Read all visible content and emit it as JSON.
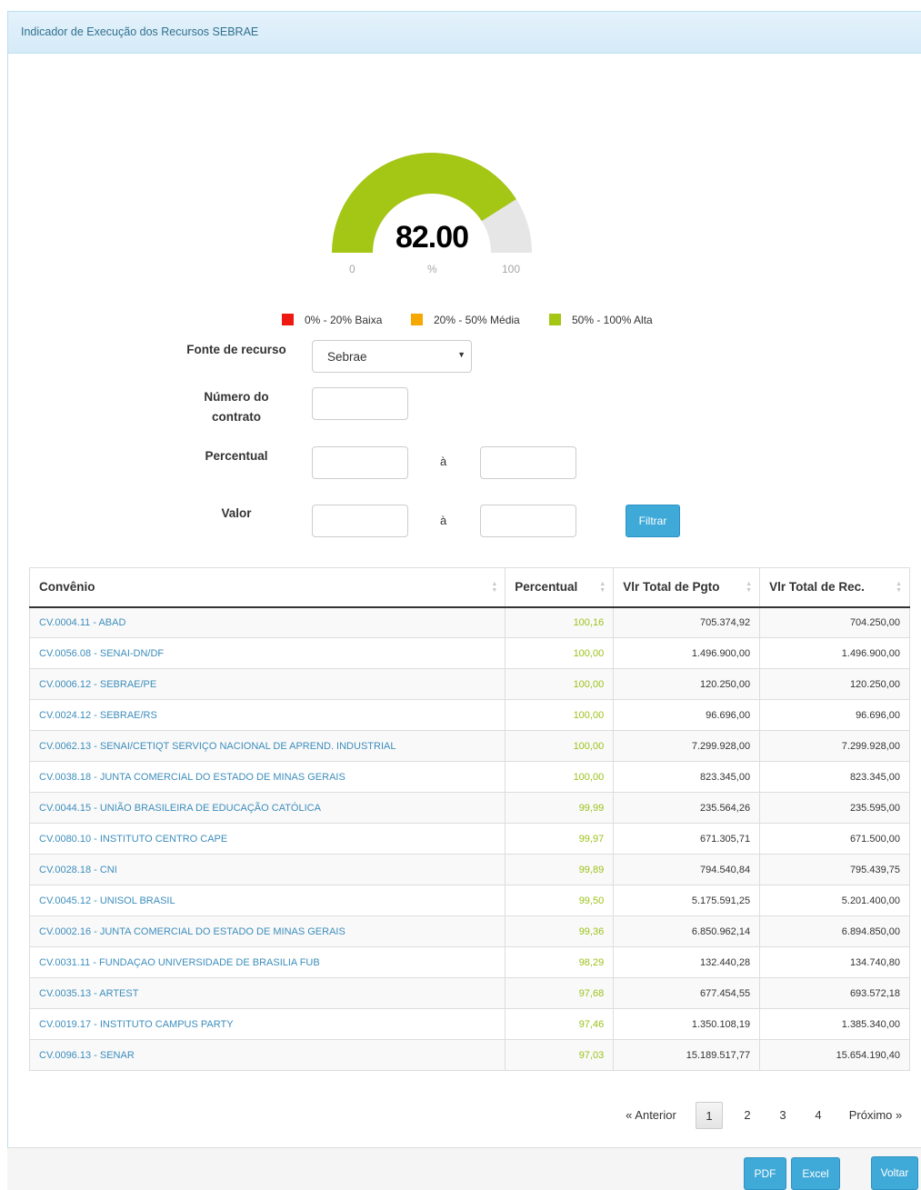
{
  "panel": {
    "title": "Indicador de Execução dos Recursos SEBRAE"
  },
  "gauge": {
    "value_label": "82.00",
    "value": 82.0,
    "min_label": "0",
    "max_label": "100",
    "unit": "%",
    "fill_color": "#a4c615",
    "track_color": "#e6e6e6"
  },
  "legend": [
    {
      "label": "0% - 20% Baixa",
      "color": "#ee1a12"
    },
    {
      "label": "20% - 50% Média",
      "color": "#f6a700"
    },
    {
      "label": "50% - 100% Alta",
      "color": "#a4c615"
    }
  ],
  "filters": {
    "fonte_label": "Fonte de recurso",
    "fonte_value": "Sebrae",
    "contrato_label": "Número do contrato",
    "percentual_label": "Percentual",
    "valor_label": "Valor",
    "range_separator": "à",
    "filter_button": "Filtrar"
  },
  "table": {
    "columns": [
      "Convênio",
      "Percentual",
      "Vlr Total de Pgto",
      "Vlr Total de Rec."
    ],
    "rows": [
      [
        "CV.0004.11 - ABAD",
        "100,16",
        "705.374,92",
        "704.250,00"
      ],
      [
        "CV.0056.08 - SENAI-DN/DF",
        "100,00",
        "1.496.900,00",
        "1.496.900,00"
      ],
      [
        "CV.0006.12 - SEBRAE/PE",
        "100,00",
        "120.250,00",
        "120.250,00"
      ],
      [
        "CV.0024.12 - SEBRAE/RS",
        "100,00",
        "96.696,00",
        "96.696,00"
      ],
      [
        "CV.0062.13 - SENAI/CETIQT SERVIÇO NACIONAL DE APREND. INDUSTRIAL",
        "100,00",
        "7.299.928,00",
        "7.299.928,00"
      ],
      [
        "CV.0038.18 - JUNTA COMERCIAL DO ESTADO DE MINAS GERAIS",
        "100,00",
        "823.345,00",
        "823.345,00"
      ],
      [
        "CV.0044.15 - UNIÃO BRASILEIRA DE EDUCAÇÃO CATÓLICA",
        "99,99",
        "235.564,26",
        "235.595,00"
      ],
      [
        "CV.0080.10 - INSTITUTO CENTRO CAPE",
        "99,97",
        "671.305,71",
        "671.500,00"
      ],
      [
        "CV.0028.18 - CNI",
        "99,89",
        "794.540,84",
        "795.439,75"
      ],
      [
        "CV.0045.12 - UNISOL BRASIL",
        "99,50",
        "5.175.591,25",
        "5.201.400,00"
      ],
      [
        "CV.0002.16 - JUNTA COMERCIAL DO ESTADO DE MINAS GERAIS",
        "99,36",
        "6.850.962,14",
        "6.894.850,00"
      ],
      [
        "CV.0031.11 - FUNDAÇAO UNIVERSIDADE DE BRASILIA FUB",
        "98,29",
        "132.440,28",
        "134.740,80"
      ],
      [
        "CV.0035.13 - ARTEST",
        "97,68",
        "677.454,55",
        "693.572,18"
      ],
      [
        "CV.0019.17 - INSTITUTO CAMPUS PARTY",
        "97,46",
        "1.350.108,19",
        "1.385.340,00"
      ],
      [
        "CV.0096.13 - SENAR",
        "97,03",
        "15.189.517,77",
        "15.654.190,40"
      ]
    ]
  },
  "pagination": {
    "prev": "« Anterior",
    "pages": [
      "1",
      "2",
      "3",
      "4"
    ],
    "current": "1",
    "next": "Próximo »"
  },
  "footer": {
    "pdf": "PDF",
    "excel": "Excel",
    "back": "Voltar"
  }
}
